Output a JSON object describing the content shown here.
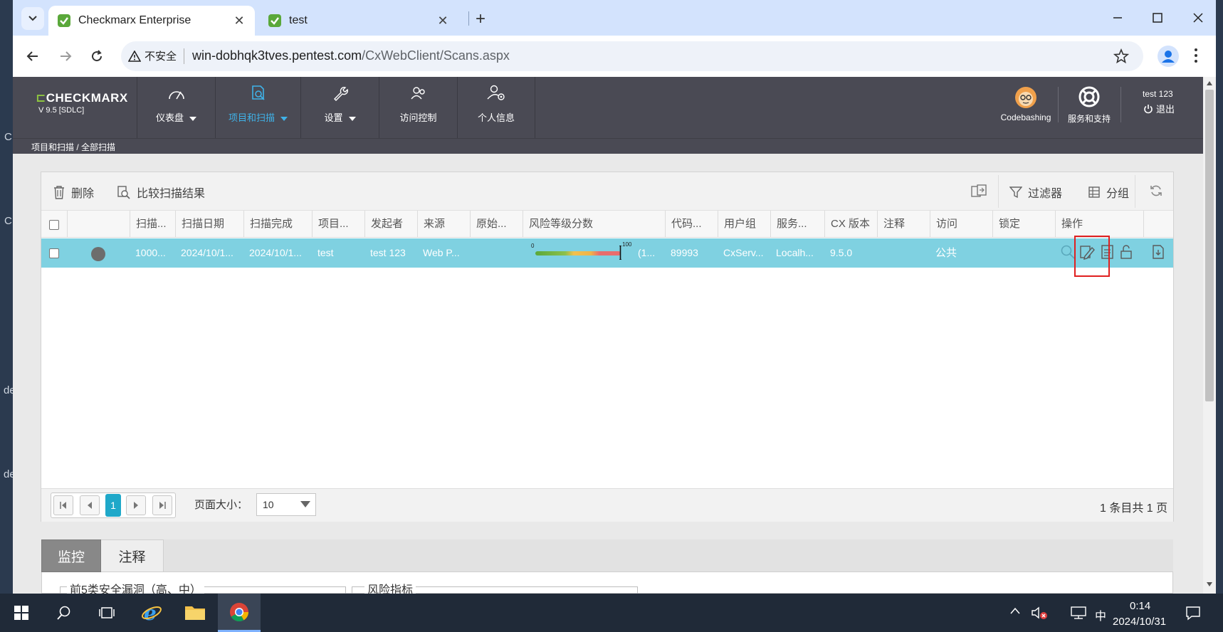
{
  "browser": {
    "tabs": [
      {
        "title": "Checkmarx Enterprise",
        "active": true
      },
      {
        "title": "test",
        "active": false
      }
    ],
    "security_label": "不安全",
    "url_host": "win-dobhqk3tves.pentest.com",
    "url_path": "/CxWebClient/Scans.aspx"
  },
  "desktop": {
    "side_letters": [
      "C",
      "C",
      "de",
      "de"
    ]
  },
  "app": {
    "brand": "CHECKMARX",
    "version": "V 9.5  [SDLC]",
    "nav": [
      {
        "label": "仪表盘",
        "icon": "gauge-icon",
        "dropdown": true
      },
      {
        "label": "项目和扫描",
        "icon": "project-scan-icon",
        "dropdown": true,
        "active": true
      },
      {
        "label": "设置",
        "icon": "wrench-icon",
        "dropdown": true
      },
      {
        "label": "访问控制",
        "icon": "access-control-icon",
        "dropdown": false
      },
      {
        "label": "个人信息",
        "icon": "personal-info-icon",
        "dropdown": false
      }
    ],
    "codebashing_label": "Codebashing",
    "support_label": "服务和支持",
    "user_name": "test 123",
    "logout_label": "退出",
    "breadcrumb": "项目和扫描 / 全部扫描",
    "accent_color": "#3fb2e8",
    "brand_color": "#8ec63f"
  },
  "grid": {
    "toolbar": {
      "delete_label": "删除",
      "compare_label": "比较扫描结果",
      "filter_label": "过滤器",
      "group_label": "分组"
    },
    "columns": [
      "扫描...",
      "扫描日期",
      "扫描完成",
      "项目...",
      "发起者",
      "来源",
      "原始...",
      "风险等级分数",
      "代码...",
      "用户组",
      "服务...",
      "CX 版本",
      "注释",
      "访问",
      "锁定",
      "操作"
    ],
    "row": {
      "scan_id": "1000...",
      "scan_date": "2024/10/1...",
      "scan_complete": "2024/10/1...",
      "project": "test",
      "initiator": "test 123",
      "origin": "Web P...",
      "original": "",
      "risk_score_min": "0",
      "risk_score_max": "100",
      "risk_score": 100,
      "risk_score_text": "(1...",
      "loc": "89993",
      "team": "CxServ...",
      "server": "Localh...",
      "cx_version": "9.5.0",
      "comment": "",
      "access": "公共",
      "row_color": "#7fd1e1"
    },
    "pager": {
      "current_page": "1",
      "page_size_label": "页面大小：",
      "page_size": "10",
      "summary": "1 条目共 1 页"
    }
  },
  "bottom_tabs": {
    "monitor_label": "监控",
    "notes_label": "注释",
    "section1_title": "前5类安全漏洞（高、中）",
    "section2_title": "风险指标"
  },
  "taskbar": {
    "ime": "中",
    "time": "0:14",
    "date": "2024/10/31"
  }
}
